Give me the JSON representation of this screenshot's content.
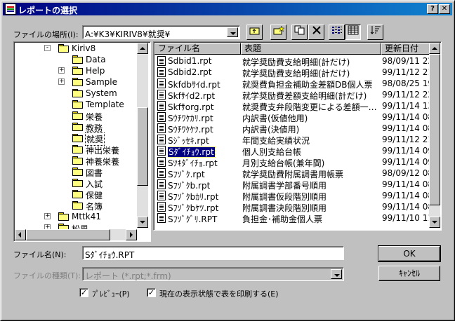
{
  "window": {
    "title": "レポートの選択",
    "help_btn": "?",
    "close_btn": "✕"
  },
  "location": {
    "label": "ファイルの場所(I):",
    "value": "A:¥K3¥KIRIV8¥就奨¥"
  },
  "toolbar": {
    "up_icon": "up-folder-icon",
    "new_icon": "new-folder-icon",
    "copy_icon": "copy-icon",
    "delete_icon": "delete-icon",
    "list_icon": "list-view-icon",
    "details_icon": "details-view-icon",
    "sort_icon": "sort-icon"
  },
  "tree": [
    {
      "label": "Kiriv8",
      "level": 0,
      "expander": "-"
    },
    {
      "label": "Data",
      "level": 1,
      "expander": ""
    },
    {
      "label": "Help",
      "level": 1,
      "expander": "+"
    },
    {
      "label": "Sample",
      "level": 1,
      "expander": "+"
    },
    {
      "label": "System",
      "level": 1,
      "expander": ""
    },
    {
      "label": "Template",
      "level": 1,
      "expander": ""
    },
    {
      "label": "栄養",
      "level": 1,
      "expander": ""
    },
    {
      "label": "教務",
      "level": 1,
      "expander": ""
    },
    {
      "label": "就奨",
      "level": 1,
      "expander": "",
      "selected": true
    },
    {
      "label": "神出栄養",
      "level": 1,
      "expander": ""
    },
    {
      "label": "神養栄養",
      "level": 1,
      "expander": ""
    },
    {
      "label": "図書",
      "level": 1,
      "expander": ""
    },
    {
      "label": "入試",
      "level": 1,
      "expander": ""
    },
    {
      "label": "保健",
      "level": 1,
      "expander": ""
    },
    {
      "label": "名簿",
      "level": 1,
      "expander": ""
    },
    {
      "label": "Mttk41",
      "level": 0,
      "expander": "+"
    },
    {
      "label": "松風",
      "level": 0,
      "expander": "+"
    }
  ],
  "columns": {
    "name": "ファイル名",
    "title": "表題",
    "date": "更新日付"
  },
  "files": [
    {
      "name": "Sdbid1.rpt",
      "title": "就学奨励費支給明細(計だけ)",
      "date": "98/09/11 22"
    },
    {
      "name": "Sdbid2.rpt",
      "title": "就学奨励費支給明細(計だけ)",
      "date": "99/11/12 21"
    },
    {
      "name": "Skfdbｻｲd.rpt",
      "title": "就奨費負担金補助金差額DB個人票",
      "date": "98/08/25 19"
    },
    {
      "name": "Skfｻｲd2.rpt",
      "title": "就学奨励費差額支給明細(計だけ)",
      "date": "99/11/12 22"
    },
    {
      "name": "Skfｻorg.rpt",
      "title": "就奨費支弁段階変更による差額一…",
      "date": "99/11/14 13"
    },
    {
      "name": "Sｳﾁﾜｹｶﾘ.rpt",
      "title": "内訳書(仮値他用)",
      "date": "99/11/14 08"
    },
    {
      "name": "Sｳﾁﾜｹｹﾂ.rpt",
      "title": "内訳書(決値用)",
      "date": "99/11/14 08"
    },
    {
      "name": "Sｼﾞｯｾｷ.rpt",
      "title": "年間支給実績状況",
      "date": "99/11/12 21"
    },
    {
      "name": "Sﾀﾞｲﾁｮｳ.rpt",
      "title": "個人別支給台帳",
      "date": "99/11/14 09",
      "selected": true
    },
    {
      "name": "Sﾂｷﾀﾞｲﾁｮ.rpt",
      "title": "月別支給台帳(兼年間)",
      "date": "99/11/14 09"
    },
    {
      "name": "Sﾌｿﾞｸ.rpt",
      "title": "就学奨励費附属調書用帳票",
      "date": "98/09/12 08"
    },
    {
      "name": "Sﾌｿﾞｸb.rpt",
      "title": "附属調書学部番号順用",
      "date": "99/11/14 08"
    },
    {
      "name": "Sﾌｿﾞｸbｶﾘ.rpt",
      "title": "附属調書仮段階別順用",
      "date": "99/11/14 08"
    },
    {
      "name": "Sﾌｿﾞｸbｹﾂ.rpt",
      "title": "附属調書決段階別順用",
      "date": "99/11/14 08"
    },
    {
      "name": "Sﾌｿﾞｸﾞﾘ.RPT",
      "title": "負担金･補助金個人票",
      "date": "99/11/10 11"
    }
  ],
  "filename": {
    "label": "ファイル名(N):",
    "value": "Sﾀﾞｲﾁｮｳ.RPT"
  },
  "filetype": {
    "label": "ファイルの種類(T):",
    "value": "レポート (*.rpt;*.frm)"
  },
  "buttons": {
    "ok": "OK",
    "cancel": "ｷｬﾝｾﾙ"
  },
  "options": {
    "preview": "ﾌﾟﾚﾋﾞｭｰ(P)",
    "print_current": "現在の表示状態で表を印刷する(E)",
    "check_mark": "✓"
  }
}
